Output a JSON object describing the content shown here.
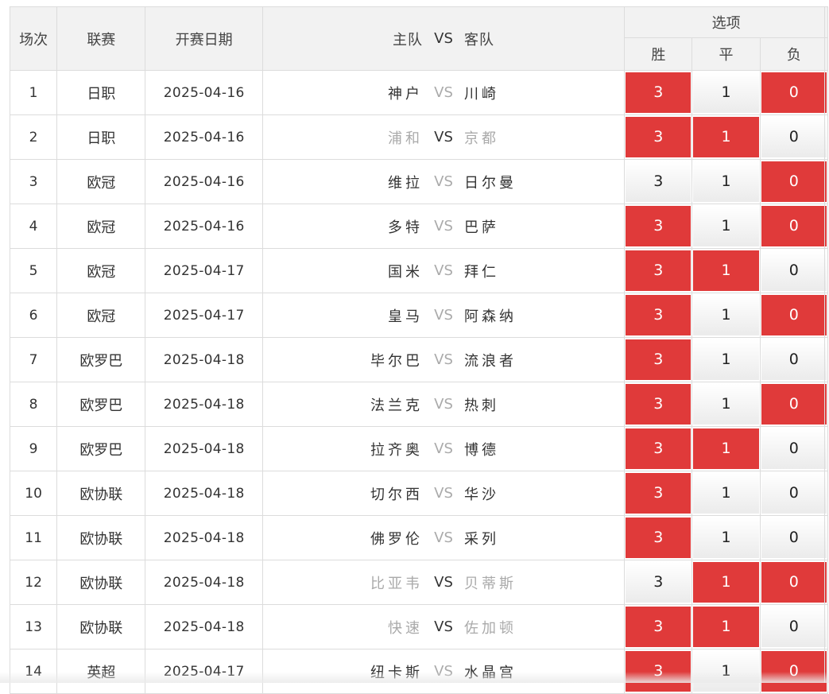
{
  "header": {
    "no": "场次",
    "league": "联赛",
    "date": "开赛日期",
    "home": "主队",
    "vs": "VS",
    "away": "客队",
    "options": "选项",
    "win": "胜",
    "draw": "平",
    "lose": "负"
  },
  "colors": {
    "selected": "#e03a3a",
    "unselected": "#f0f0f0",
    "dim": "#aaaaaa"
  },
  "rows": [
    {
      "no": "1",
      "league": "日职",
      "date": "2025-04-16",
      "home": "神户",
      "vs": "VS",
      "away": "川崎",
      "v3": "3",
      "v1": "1",
      "v0": "0",
      "sel": [
        true,
        false,
        true
      ],
      "dim_teams": false
    },
    {
      "no": "2",
      "league": "日职",
      "date": "2025-04-16",
      "home": "浦和",
      "vs": "VS",
      "away": "京都",
      "v3": "3",
      "v1": "1",
      "v0": "0",
      "sel": [
        true,
        true,
        false
      ],
      "dim_teams": true
    },
    {
      "no": "3",
      "league": "欧冠",
      "date": "2025-04-16",
      "home": "维拉",
      "vs": "VS",
      "away": "日尔曼",
      "v3": "3",
      "v1": "1",
      "v0": "0",
      "sel": [
        false,
        false,
        true
      ],
      "dim_teams": false
    },
    {
      "no": "4",
      "league": "欧冠",
      "date": "2025-04-16",
      "home": "多特",
      "vs": "VS",
      "away": "巴萨",
      "v3": "3",
      "v1": "1",
      "v0": "0",
      "sel": [
        true,
        false,
        true
      ],
      "dim_teams": false
    },
    {
      "no": "5",
      "league": "欧冠",
      "date": "2025-04-17",
      "home": "国米",
      "vs": "VS",
      "away": "拜仁",
      "v3": "3",
      "v1": "1",
      "v0": "0",
      "sel": [
        true,
        true,
        false
      ],
      "dim_teams": false
    },
    {
      "no": "6",
      "league": "欧冠",
      "date": "2025-04-17",
      "home": "皇马",
      "vs": "VS",
      "away": "阿森纳",
      "v3": "3",
      "v1": "1",
      "v0": "0",
      "sel": [
        true,
        false,
        true
      ],
      "dim_teams": false
    },
    {
      "no": "7",
      "league": "欧罗巴",
      "date": "2025-04-18",
      "home": "毕尔巴",
      "vs": "VS",
      "away": "流浪者",
      "v3": "3",
      "v1": "1",
      "v0": "0",
      "sel": [
        true,
        false,
        false
      ],
      "dim_teams": false
    },
    {
      "no": "8",
      "league": "欧罗巴",
      "date": "2025-04-18",
      "home": "法兰克",
      "vs": "VS",
      "away": "热刺",
      "v3": "3",
      "v1": "1",
      "v0": "0",
      "sel": [
        true,
        false,
        true
      ],
      "dim_teams": false
    },
    {
      "no": "9",
      "league": "欧罗巴",
      "date": "2025-04-18",
      "home": "拉齐奥",
      "vs": "VS",
      "away": "博德",
      "v3": "3",
      "v1": "1",
      "v0": "0",
      "sel": [
        true,
        true,
        false
      ],
      "dim_teams": false
    },
    {
      "no": "10",
      "league": "欧协联",
      "date": "2025-04-18",
      "home": "切尔西",
      "vs": "VS",
      "away": "华沙",
      "v3": "3",
      "v1": "1",
      "v0": "0",
      "sel": [
        true,
        false,
        false
      ],
      "dim_teams": false
    },
    {
      "no": "11",
      "league": "欧协联",
      "date": "2025-04-18",
      "home": "佛罗伦",
      "vs": "VS",
      "away": "采列",
      "v3": "3",
      "v1": "1",
      "v0": "0",
      "sel": [
        true,
        false,
        false
      ],
      "dim_teams": false
    },
    {
      "no": "12",
      "league": "欧协联",
      "date": "2025-04-18",
      "home": "比亚韦",
      "vs": "VS",
      "away": "贝蒂斯",
      "v3": "3",
      "v1": "1",
      "v0": "0",
      "sel": [
        false,
        true,
        true
      ],
      "dim_teams": true
    },
    {
      "no": "13",
      "league": "欧协联",
      "date": "2025-04-18",
      "home": "快速",
      "vs": "VS",
      "away": "佐加顿",
      "v3": "3",
      "v1": "1",
      "v0": "0",
      "sel": [
        true,
        true,
        false
      ],
      "dim_teams": true
    },
    {
      "no": "14",
      "league": "英超",
      "date": "2025-04-17",
      "home": "纽卡斯",
      "vs": "VS",
      "away": "水晶宫",
      "v3": "3",
      "v1": "1",
      "v0": "0",
      "sel": [
        true,
        false,
        true
      ],
      "dim_teams": false
    }
  ]
}
